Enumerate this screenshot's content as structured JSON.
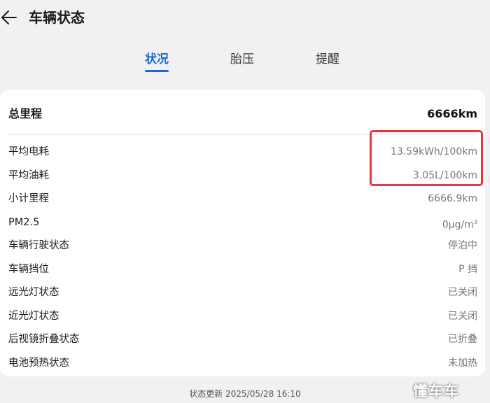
{
  "header": {
    "title": "车辆状态"
  },
  "tabs": [
    {
      "label": "状况",
      "active": true
    },
    {
      "label": "胎压",
      "active": false
    },
    {
      "label": "提醒",
      "active": false
    }
  ],
  "total": {
    "label": "总里程",
    "value": "6666km"
  },
  "rows": [
    {
      "label": "平均电耗",
      "value": "13.59kWh/100km"
    },
    {
      "label": "平均油耗",
      "value": "3.05L/100km"
    },
    {
      "label": "小计里程",
      "value": "6666.9km"
    },
    {
      "label": "PM2.5",
      "value": "0μg/m",
      "sup": "3"
    },
    {
      "label": "车辆行驶状态",
      "value": "停泊中"
    },
    {
      "label": "车辆挡位",
      "value": "P 挡"
    },
    {
      "label": "远光灯状态",
      "value": "已关闭"
    },
    {
      "label": "近光灯状态",
      "value": "已关闭"
    },
    {
      "label": "后视镜折叠状态",
      "value": "已折叠"
    },
    {
      "label": "电池预热状态",
      "value": "未加热"
    }
  ],
  "footer": {
    "status_update": "状态更新 2025/05/28 16:10"
  },
  "watermark": "懂车车",
  "colors": {
    "accent": "#1869d6",
    "highlight": "#e5383f",
    "background": "#f1f1f3",
    "card": "#ffffff"
  }
}
